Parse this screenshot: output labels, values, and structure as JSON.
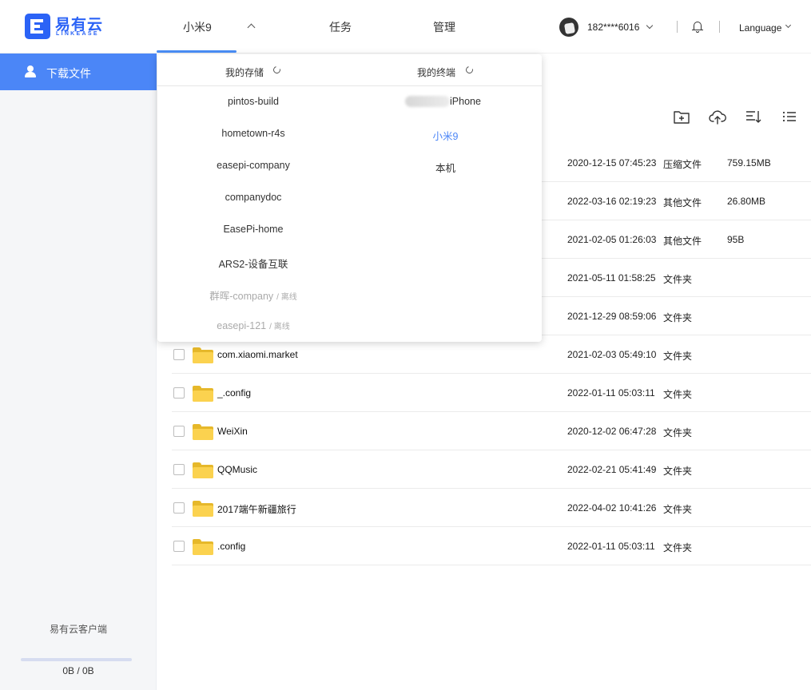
{
  "brand": {
    "name": "易有云",
    "sub": "LINKEASE",
    "color": "#2b63f6"
  },
  "nav": {
    "device": "小米9",
    "tasks": "任务",
    "manage": "管理"
  },
  "user": {
    "phone": "182****6016",
    "language": "Language"
  },
  "sidebar": {
    "active_item": "下载文件",
    "client_label": "易有云客户端",
    "quota": "0B / 0B",
    "progress_fraction": 0
  },
  "dropdown": {
    "storage_title": "我的存储",
    "terminal_title": "我的终端",
    "offline_tag": "/ 离线",
    "storage": [
      {
        "name": "pintos-build"
      },
      {
        "name": "hometown-r4s"
      },
      {
        "name": "easepi-company"
      },
      {
        "name": "companydoc"
      },
      {
        "name": "EasePi-home"
      },
      {
        "name": "ARS2-设备互联"
      },
      {
        "name": "群晖-company",
        "offline": true
      },
      {
        "name": "easepi-121",
        "offline": true
      }
    ],
    "terminals": [
      {
        "name": "iPhone"
      },
      {
        "name": "小米9",
        "active": true
      },
      {
        "name": "本机"
      }
    ]
  },
  "files": [
    {
      "name": "",
      "date": "2020-12-15 07:45:23",
      "type": "压缩文件",
      "size": "759.15MB"
    },
    {
      "name": "",
      "date": "2022-03-16 02:19:23",
      "type": "其他文件",
      "size": "26.80MB"
    },
    {
      "name": "",
      "date": "2021-02-05 01:26:03",
      "type": "其他文件",
      "size": "95B"
    },
    {
      "name": "",
      "date": "2021-05-11 01:58:25",
      "type": "文件夹",
      "size": ""
    },
    {
      "name": "",
      "date": "2021-12-29 08:59:06",
      "type": "文件夹",
      "size": ""
    },
    {
      "name": "com.xiaomi.market",
      "date": "2021-02-03 05:49:10",
      "type": "文件夹",
      "size": ""
    },
    {
      "name": "_.config",
      "date": "2022-01-11 05:03:11",
      "type": "文件夹",
      "size": ""
    },
    {
      "name": "WeiXin",
      "date": "2020-12-02 06:47:28",
      "type": "文件夹",
      "size": ""
    },
    {
      "name": "QQMusic",
      "date": "2022-02-21 05:41:49",
      "type": "文件夹",
      "size": ""
    },
    {
      "name": "2017端午新疆旅行",
      "date": "2022-04-02 10:41:26",
      "type": "文件夹",
      "size": ""
    },
    {
      "name": ".config",
      "date": "2022-01-11 05:03:11",
      "type": "文件夹",
      "size": ""
    }
  ],
  "colors": {
    "accent": "#4b86f7",
    "folder": "#fbd24f"
  }
}
